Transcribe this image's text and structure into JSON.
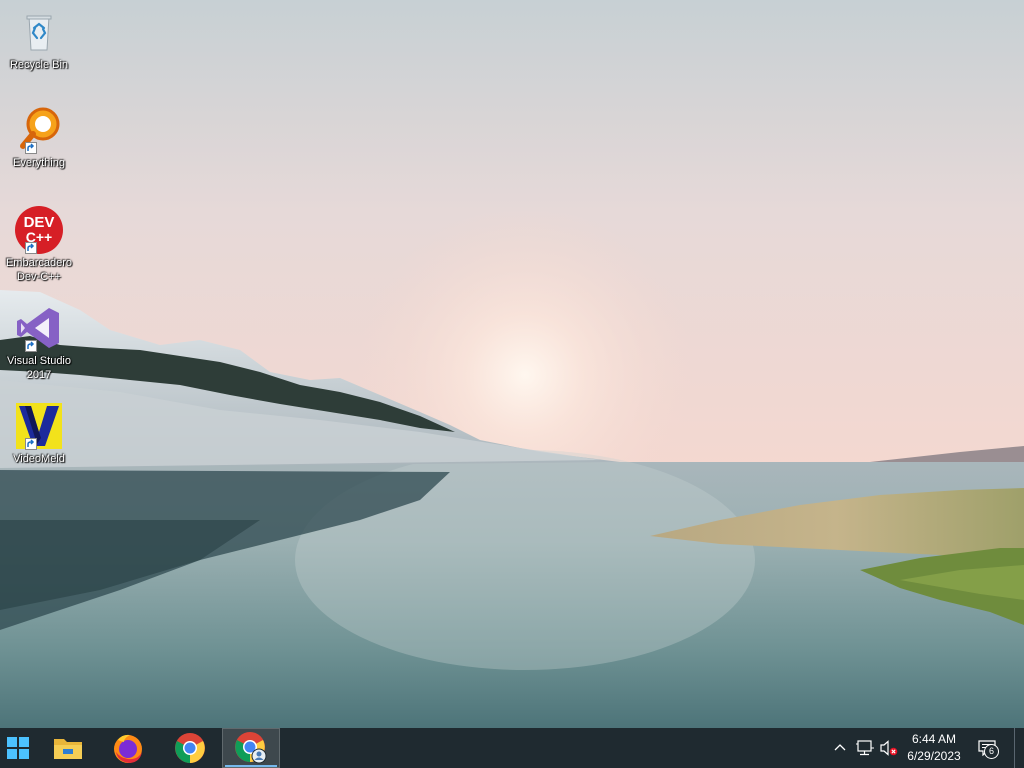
{
  "desktop": {
    "icons": [
      {
        "id": "recycle-bin",
        "label": "Recycle Bin",
        "shortcut": false,
        "icon": "recycle-bin-icon"
      },
      {
        "id": "everything",
        "label": "Everything",
        "shortcut": true,
        "icon": "everything-search-icon"
      },
      {
        "id": "devcpp",
        "label": "Embarcadero Dev-C++",
        "shortcut": true,
        "icon": "devcpp-icon",
        "icon_text_top": "DEV",
        "icon_text_bottom": "C++"
      },
      {
        "id": "visual-studio",
        "label": "Visual Studio 2017",
        "shortcut": true,
        "icon": "visual-studio-icon"
      },
      {
        "id": "videomeld",
        "label": "VideoMeld",
        "shortcut": true,
        "icon": "videomeld-icon"
      }
    ]
  },
  "taskbar": {
    "pinned": [
      {
        "name": "start-button",
        "icon": "windows-logo-icon"
      },
      {
        "name": "file-explorer",
        "icon": "folder-icon"
      },
      {
        "name": "firefox",
        "icon": "firefox-icon"
      },
      {
        "name": "chrome",
        "icon": "chrome-icon"
      },
      {
        "name": "chrome-profile",
        "icon": "chrome-profile-icon",
        "active": true
      }
    ],
    "tray": {
      "icons": [
        "chevron-up-icon",
        "network-icon",
        "volume-muted-icon"
      ],
      "time": "6:44 AM",
      "date": "6/29/2023",
      "notifications_count": "6"
    }
  },
  "colors": {
    "taskbar": "#1f2a30",
    "sky_top": "#c9d1d4",
    "sky_horizon": "#f3d9d2",
    "water": "#6f8f92",
    "accent": "#76b9ed"
  }
}
